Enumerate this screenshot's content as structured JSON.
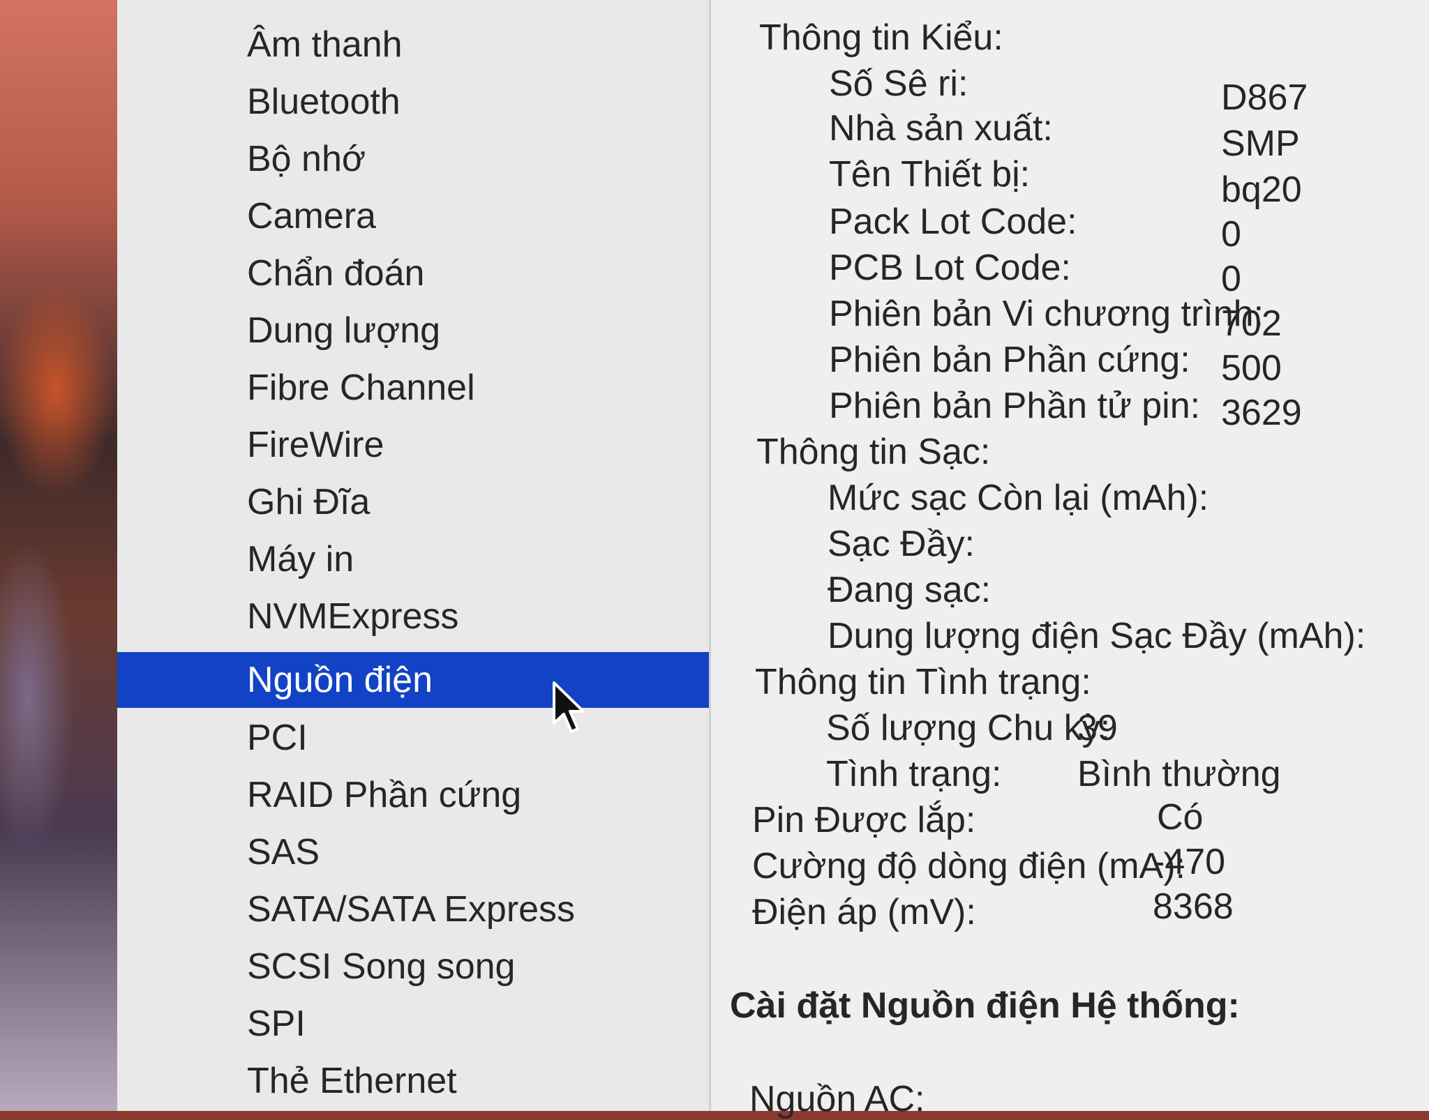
{
  "sidebar": {
    "items": [
      {
        "label": "Âm thanh"
      },
      {
        "label": "Bluetooth"
      },
      {
        "label": "Bộ nhớ"
      },
      {
        "label": "Camera"
      },
      {
        "label": "Chẩn đoán"
      },
      {
        "label": "Dung lượng"
      },
      {
        "label": "Fibre Channel"
      },
      {
        "label": "FireWire"
      },
      {
        "label": "Ghi Đĩa"
      },
      {
        "label": "Máy in"
      },
      {
        "label": "NVMExpress"
      },
      {
        "label": "Nguồn điện",
        "selected": true
      },
      {
        "label": "PCI"
      },
      {
        "label": "RAID Phần cứng"
      },
      {
        "label": "SAS"
      },
      {
        "label": "SATA/SATA Express"
      },
      {
        "label": "SCSI Song song"
      },
      {
        "label": "SPI"
      },
      {
        "label": "Thẻ Ethernet"
      }
    ],
    "selected_color": "#1143c4"
  },
  "details": {
    "model_info": {
      "heading": "Thông tin Kiểu:",
      "serial_label": "Số Sê ri:",
      "serial_value": "D867",
      "manufacturer_label": "Nhà sản xuất:",
      "manufacturer_value": "SMP",
      "device_name_label": "Tên Thiết bị:",
      "device_name_value": "bq20",
      "pack_lot_label": "Pack Lot Code:",
      "pack_lot_value": "0",
      "pcb_lot_label": "PCB Lot Code:",
      "pcb_lot_value": "0",
      "firmware_label": "Phiên bản Vi chương trình:",
      "firmware_value": "702",
      "hardware_label": "Phiên bản Phần cứng:",
      "hardware_value": "500",
      "cell_revision_label": "Phiên bản Phần tử pin:",
      "cell_revision_value": "3629"
    },
    "charge_info": {
      "heading": "Thông tin Sạc:",
      "remaining_label": "Mức sạc Còn lại (mAh):",
      "full_label": "Sạc Đầy:",
      "charging_label": "Đang sạc:",
      "full_capacity_label": "Dung lượng điện Sạc Đầy (mAh):"
    },
    "health_info": {
      "heading": "Thông tin Tình trạng:",
      "cycle_label": "Số lượng Chu kỳ:",
      "cycle_value": "39",
      "condition_label": "Tình trạng:",
      "condition_value": "Bình thường"
    },
    "installed_label": "Pin Được lắp:",
    "installed_value": "Có",
    "amperage_label": "Cường độ dòng điện (mA):",
    "amperage_value": "-470",
    "voltage_label": "Điện áp (mV):",
    "voltage_value": "8368",
    "system_power_heading": "Cài đặt Nguồn điện Hệ thống:",
    "ac_power_label": "Nguồn AC:"
  }
}
